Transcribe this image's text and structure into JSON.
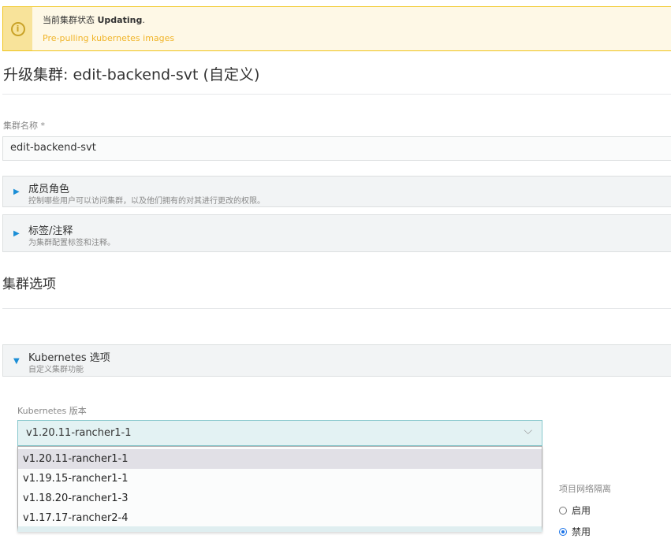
{
  "banner": {
    "status_prefix": "当前集群状态",
    "status": "Updating",
    "status_suffix": ".",
    "message": "Pre-pulling kubernetes images",
    "icon": "info-icon"
  },
  "page_title": "升级集群: edit-backend-svt (自定义)",
  "cluster_name": {
    "label": "集群名称 *",
    "value": "edit-backend-svt"
  },
  "accordions": [
    {
      "title": "成员角色",
      "subtitle": "控制哪些用户可以访问集群，以及他们拥有的对其进行更改的权限。"
    },
    {
      "title": "标签/注释",
      "subtitle": "为集群配置标签和注释。"
    }
  ],
  "section_title": "集群选项",
  "k8s_options": {
    "title": "Kubernetes 选项",
    "subtitle": "自定义集群功能"
  },
  "k8s_version": {
    "label": "Kubernetes 版本",
    "selected": "v1.20.11-rancher1-1",
    "options": [
      "v1.20.11-rancher1-1",
      "v1.19.15-rancher1-1",
      "v1.18.20-rancher1-3",
      "v1.17.17-rancher2-4"
    ]
  },
  "network_isolation": {
    "label": "项目网络隔离",
    "options": [
      {
        "label": "启用",
        "checked": false
      },
      {
        "label": "禁用",
        "checked": true
      }
    ]
  }
}
